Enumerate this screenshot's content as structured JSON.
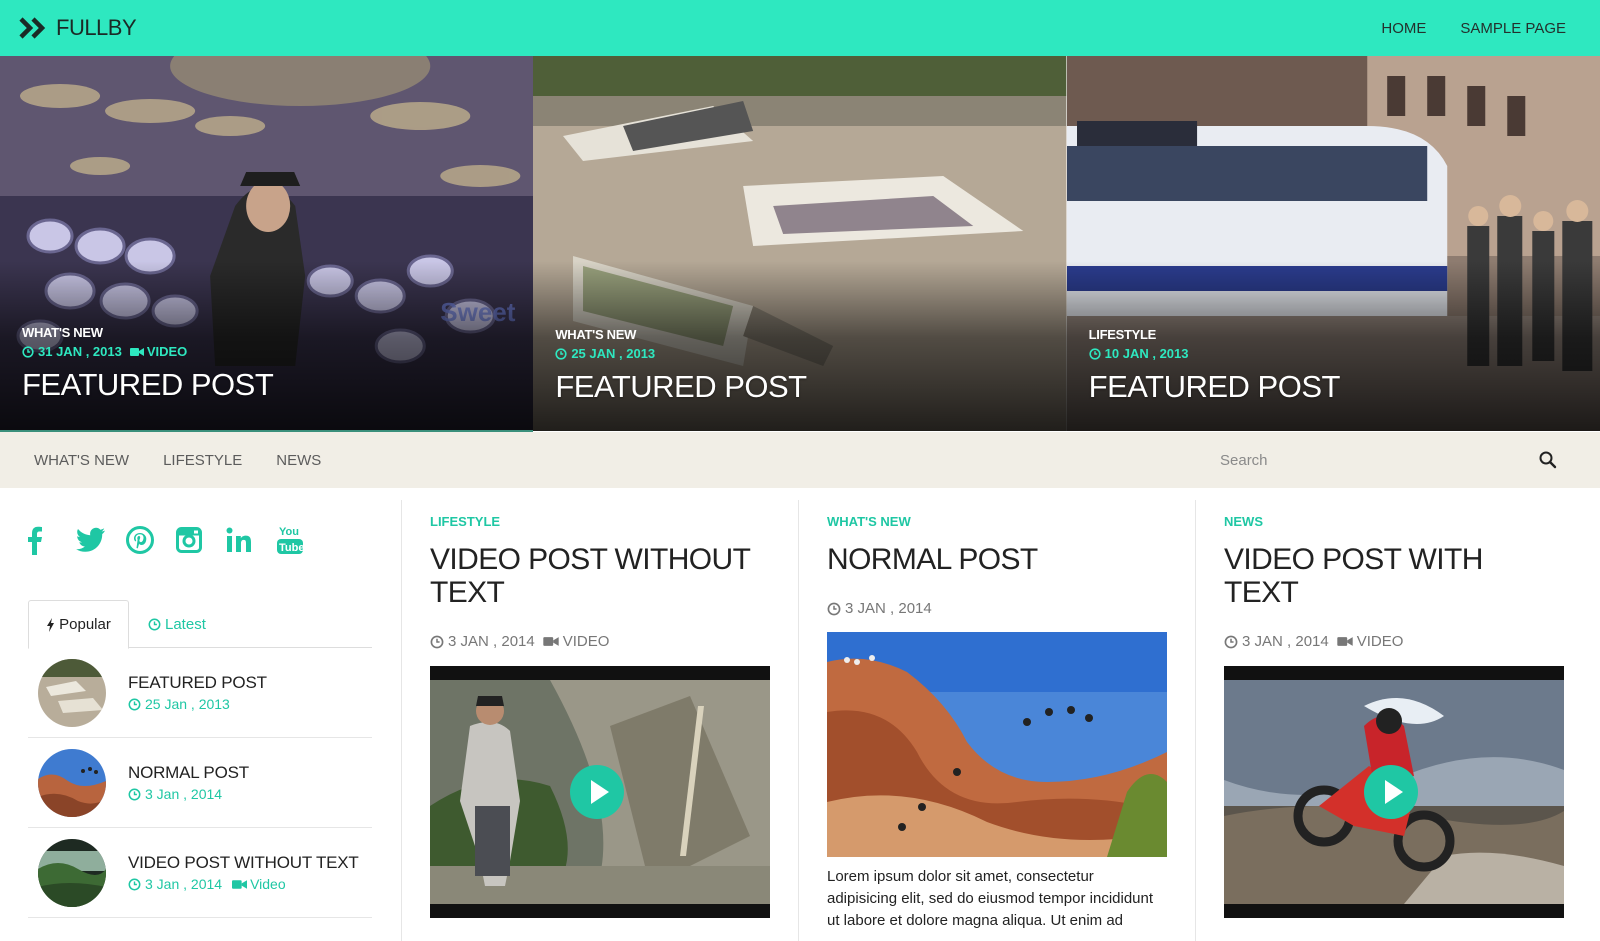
{
  "header": {
    "logo_text": "FULLBY",
    "nav": [
      "HOME",
      "SAMPLE PAGE"
    ]
  },
  "hero": {
    "slides": [
      {
        "category": "WHAT'S NEW",
        "date": "31 JAN , 2013",
        "format": "VIDEO",
        "title": "FEATURED POST"
      },
      {
        "category": "WHAT'S NEW",
        "date": "25 JAN , 2013",
        "format": "",
        "title": "FEATURED POST"
      },
      {
        "category": "LIFESTYLE",
        "date": "10 JAN , 2013",
        "format": "",
        "title": "FEATURED POST"
      }
    ]
  },
  "subnav": {
    "links": [
      "WHAT'S NEW",
      "LIFESTYLE",
      "NEWS"
    ],
    "search_placeholder": "Search"
  },
  "sidebar": {
    "socials": [
      "facebook-icon",
      "twitter-icon",
      "pinterest-icon",
      "instagram-icon",
      "linkedin-icon",
      "youtube-icon"
    ],
    "tabs": {
      "popular": "Popular",
      "latest": "Latest"
    },
    "posts": [
      {
        "title": "FEATURED POST",
        "date": "25 Jan , 2013",
        "format": ""
      },
      {
        "title": "NORMAL POST",
        "date": "3 Jan , 2014",
        "format": ""
      },
      {
        "title": "VIDEO POST WITHOUT TEXT",
        "date": "3 Jan , 2014",
        "format": "Video"
      }
    ]
  },
  "articles": [
    {
      "category": "LIFESTYLE",
      "title": "VIDEO POST WITHOUT TEXT",
      "date": "3 JAN , 2014",
      "format": "VIDEO",
      "excerpt": ""
    },
    {
      "category": "WHAT'S NEW",
      "title": "NORMAL POST",
      "date": "3 JAN , 2014",
      "format": "",
      "excerpt": "Lorem ipsum dolor sit amet, consectetur adipisicing elit, sed do eiusmod tempor incididunt ut labore et dolore magna aliqua. Ut enim ad"
    },
    {
      "category": "NEWS",
      "title": "VIDEO POST WITH TEXT",
      "date": "3 JAN , 2014",
      "format": "VIDEO",
      "excerpt": ""
    }
  ],
  "colors": {
    "accent": "#2ee8c0",
    "accent_text": "#1fc7a4",
    "subnav_bg": "#f1eee6"
  }
}
